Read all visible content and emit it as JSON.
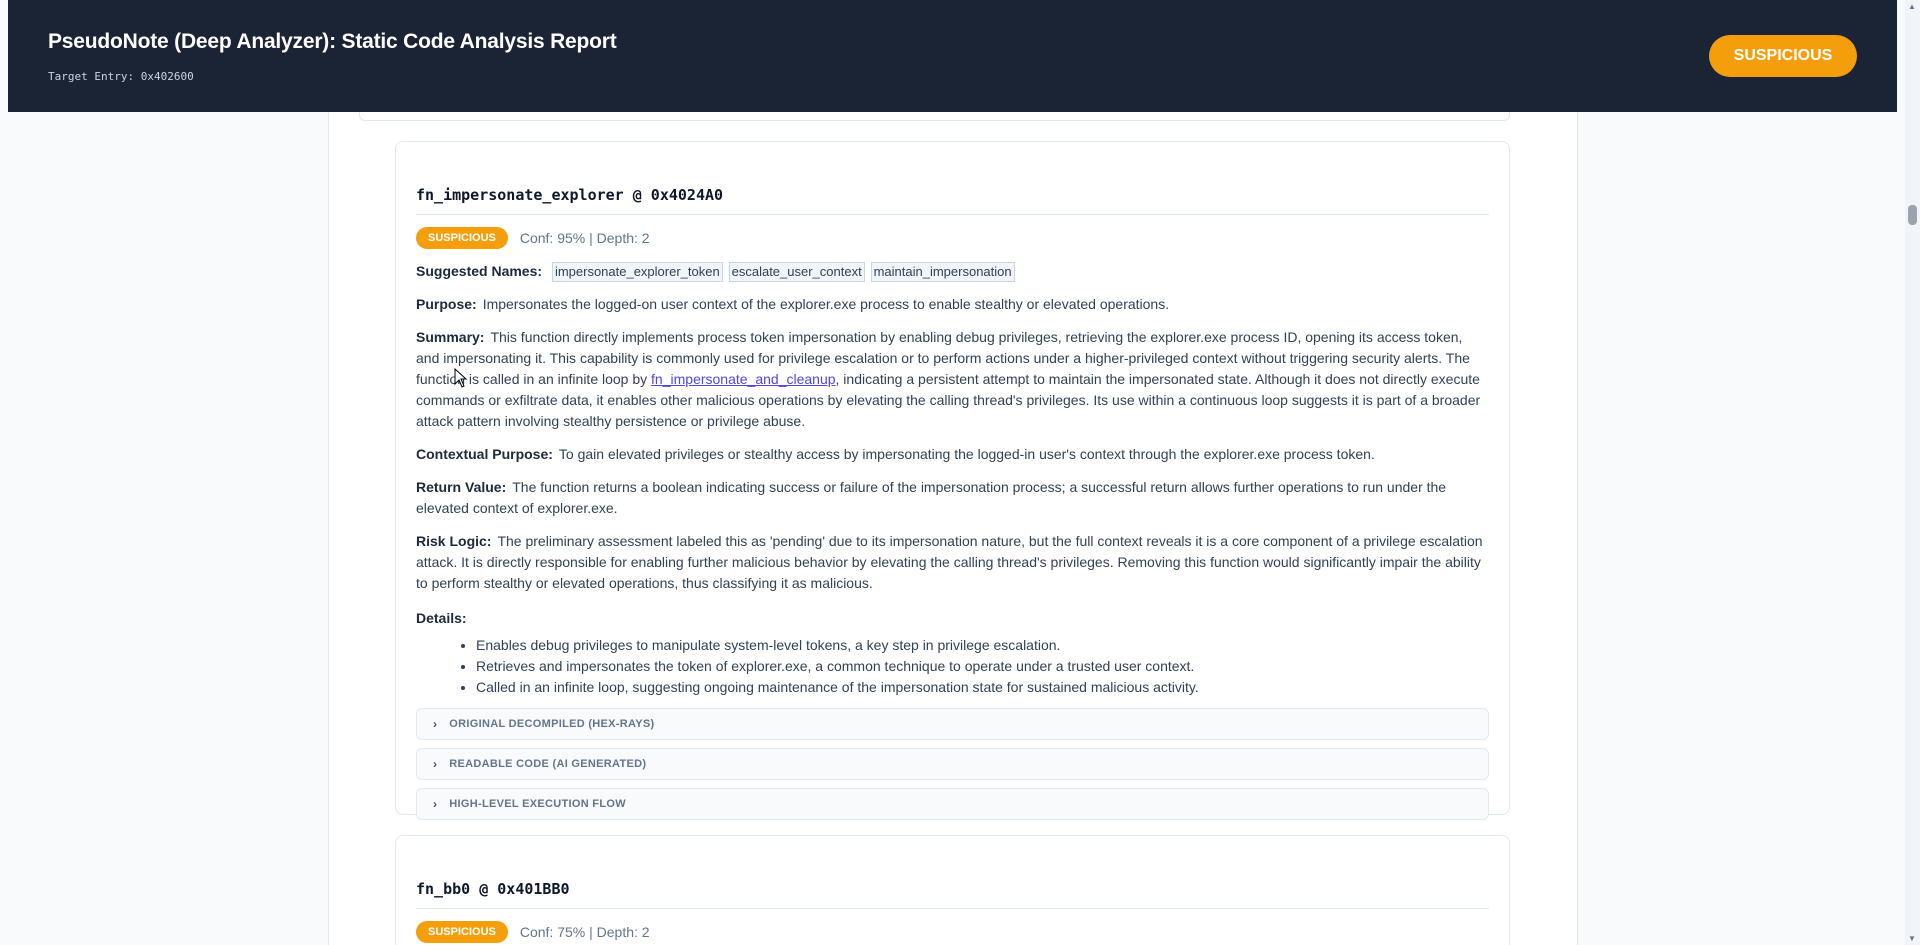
{
  "header": {
    "title": "PseudoNote (Deep Analyzer): Static Code Analysis Report",
    "target_entry": "Target Entry: 0x402600",
    "verdict": "SUSPICIOUS",
    "verdict_color": "#f59e0b"
  },
  "cards": [
    {
      "title": "fn_impersonate_explorer @ 0x4024A0",
      "badge": "SUSPICIOUS",
      "meta": "Conf: 95% | Depth: 2",
      "suggested_label": "Suggested Names:",
      "suggested_names": [
        "impersonate_explorer_token",
        "escalate_user_context",
        "maintain_impersonation"
      ],
      "purpose_label": "Purpose:",
      "purpose": "Impersonates the logged-on user context of the explorer.exe process to enable stealthy or elevated operations.",
      "summary_label": "Summary:",
      "summary_pre": "This function directly implements process token impersonation by enabling debug privileges, retrieving the explorer.exe process ID, opening its access token, and impersonating it. This capability is commonly used for privilege escalation or to perform actions under a higher-privileged context without triggering security alerts. The function is called in an infinite loop by ",
      "summary_link": "fn_impersonate_and_cleanup",
      "summary_post": ", indicating a persistent attempt to maintain the impersonated state. Although it does not directly execute commands or exfiltrate data, it enables other malicious operations by elevating the calling thread's privileges. Its use within a continuous loop suggests it is part of a broader attack pattern involving stealthy persistence or privilege abuse.",
      "contextual_label": "Contextual Purpose:",
      "contextual": "To gain elevated privileges or stealthy access by impersonating the logged-in user's context through the explorer.exe process token.",
      "return_label": "Return Value:",
      "return_value": "The function returns a boolean indicating success or failure of the impersonation process; a successful return allows further operations to run under the elevated context of explorer.exe.",
      "risk_label": "Risk Logic:",
      "risk_logic": "The preliminary assessment labeled this as 'pending' due to its impersonation nature, but the full context reveals it is a core component of a privilege escalation attack. It is directly responsible for enabling further malicious behavior by elevating the calling thread's privileges. Removing this function would significantly impair the ability to perform stealthy or elevated operations, thus classifying it as malicious.",
      "details_label": "Details:",
      "details": [
        "Enables debug privileges to manipulate system-level tokens, a key step in privilege escalation.",
        "Retrieves and impersonates the token of explorer.exe, a common technique to operate under a trusted user context.",
        "Called in an infinite loop, suggesting ongoing maintenance of the impersonation state for sustained malicious activity."
      ],
      "sections": [
        "ORIGINAL DECOMPILED (HEX-RAYS)",
        "READABLE CODE (AI GENERATED)",
        "HIGH-LEVEL EXECUTION FLOW"
      ]
    },
    {
      "title": "fn_bb0 @ 0x401BB0",
      "badge": "SUSPICIOUS",
      "meta": "Conf: 75% | Depth: 2"
    }
  ],
  "icons": {
    "chevron": "chevron-right-icon",
    "scroll_up": "scroll-up-arrow-icon",
    "scroll_down": "scroll-down-arrow-icon",
    "cursor": "mouse-pointer-icon"
  }
}
